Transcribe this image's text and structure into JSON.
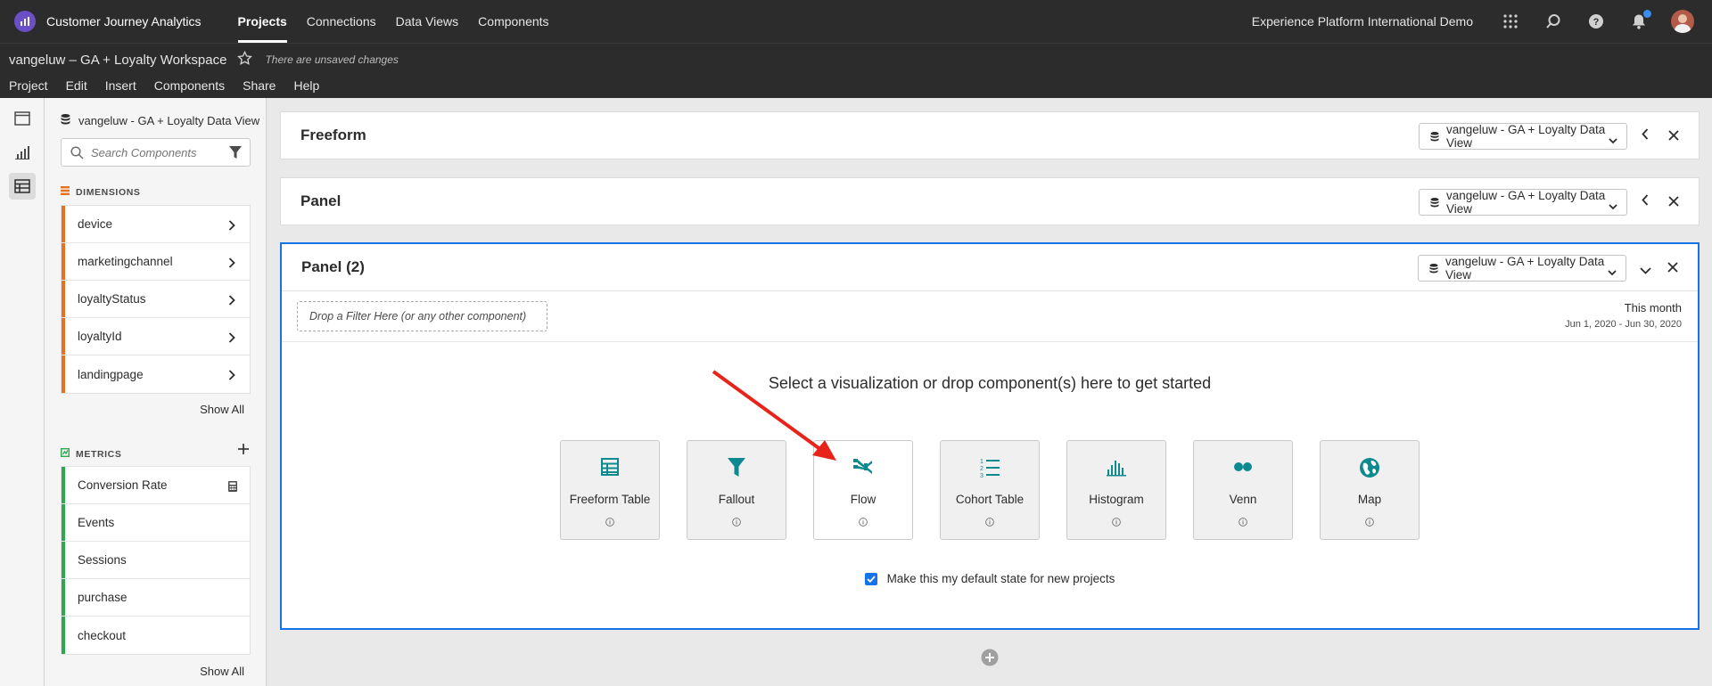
{
  "topbar": {
    "app_title": "Customer Journey Analytics",
    "nav": [
      {
        "label": "Projects",
        "active": true
      },
      {
        "label": "Connections",
        "active": false
      },
      {
        "label": "Data Views",
        "active": false
      },
      {
        "label": "Components",
        "active": false
      }
    ],
    "org_name": "Experience Platform International Demo",
    "icons": [
      "apps-grid-icon",
      "search-icon",
      "help-icon",
      "notifications-bell-icon",
      "user-avatar"
    ]
  },
  "project": {
    "title": "vangeluw – GA + Loyalty Workspace",
    "unsaved": "There are unsaved changes",
    "menu": [
      "Project",
      "Edit",
      "Insert",
      "Components",
      "Share",
      "Help"
    ]
  },
  "rail": {
    "icons": [
      "panels-icon",
      "visualizations-icon",
      "components-icon"
    ],
    "active_index": 2
  },
  "components": {
    "data_view": "vangeluw - GA + Loyalty Data View",
    "search_placeholder": "Search Components",
    "dimensions": {
      "heading": "DIMENSIONS",
      "color": "#e8711f",
      "items": [
        "device",
        "marketingchannel",
        "loyaltyStatus",
        "loyaltyId",
        "landingpage"
      ],
      "show_all": "Show All"
    },
    "metrics": {
      "heading": "METRICS",
      "color": "#2ea84f",
      "items": [
        "Conversion Rate",
        "Events",
        "Sessions",
        "purchase",
        "checkout"
      ],
      "show_all": "Show All"
    }
  },
  "panels": [
    {
      "title": "Freeform",
      "data_view": "vangeluw - GA + Loyalty Data View",
      "collapsed": true
    },
    {
      "title": "Panel",
      "data_view": "vangeluw - GA + Loyalty Data View",
      "collapsed": true
    },
    {
      "title": "Panel (2)",
      "data_view": "vangeluw - GA + Loyalty Data View",
      "collapsed": false,
      "dropzone": "Drop a Filter Here (or any other component)",
      "date_label": "This month",
      "date_range": "Jun 1, 2020 - Jun 30, 2020",
      "prompt": "Select a visualization or drop component(s) here to get started",
      "visualizations": [
        "Freeform Table",
        "Fallout",
        "Flow",
        "Cohort Table",
        "Histogram",
        "Venn",
        "Map"
      ],
      "default_checkbox": {
        "label": "Make this my default state for new projects",
        "checked": true
      }
    }
  ],
  "colors": {
    "accent": "#1473e6",
    "teal": "#0d8a8f",
    "arrow": "#e8241a"
  }
}
